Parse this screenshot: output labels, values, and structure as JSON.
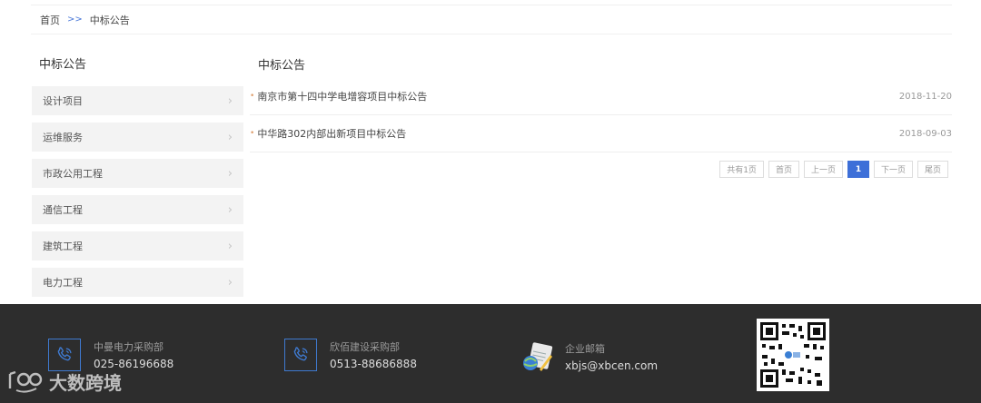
{
  "breadcrumb": {
    "home": "首页",
    "separator": ">>",
    "current": "中标公告"
  },
  "sidebar": {
    "title": "中标公告",
    "items": [
      {
        "label": "设计项目"
      },
      {
        "label": "运维服务"
      },
      {
        "label": "市政公用工程"
      },
      {
        "label": "通信工程"
      },
      {
        "label": "建筑工程"
      },
      {
        "label": "电力工程"
      }
    ],
    "chevron": "chevron-right-icon"
  },
  "main": {
    "title": "中标公告",
    "news": [
      {
        "title": "南京市第十四中学电增容项目中标公告",
        "date": "2018-11-20"
      },
      {
        "title": "中华路302内部出新项目中标公告",
        "date": "2018-09-03"
      }
    ]
  },
  "pagination": {
    "total": "共有1页",
    "first": "首页",
    "prev": "上一页",
    "current": "1",
    "next": "下一页",
    "last": "尾页"
  },
  "footer": {
    "contacts": [
      {
        "label": "中曼电力采购部",
        "value": "025-86196688",
        "icon": "phone-icon"
      },
      {
        "label": "欣佰建设采购部",
        "value": "0513-88686888",
        "icon": "phone-icon"
      },
      {
        "label": "企业邮箱",
        "value": "xbjs@xbcen.com",
        "icon": "mail-icon"
      }
    ],
    "qr_icon": "qr-code-icon"
  },
  "watermark": {
    "text": "大数跨境"
  },
  "colors": {
    "accent": "#3d6fd8",
    "footer_bg": "#2d2d2d",
    "sidebar_bg": "#f3f3f3"
  }
}
